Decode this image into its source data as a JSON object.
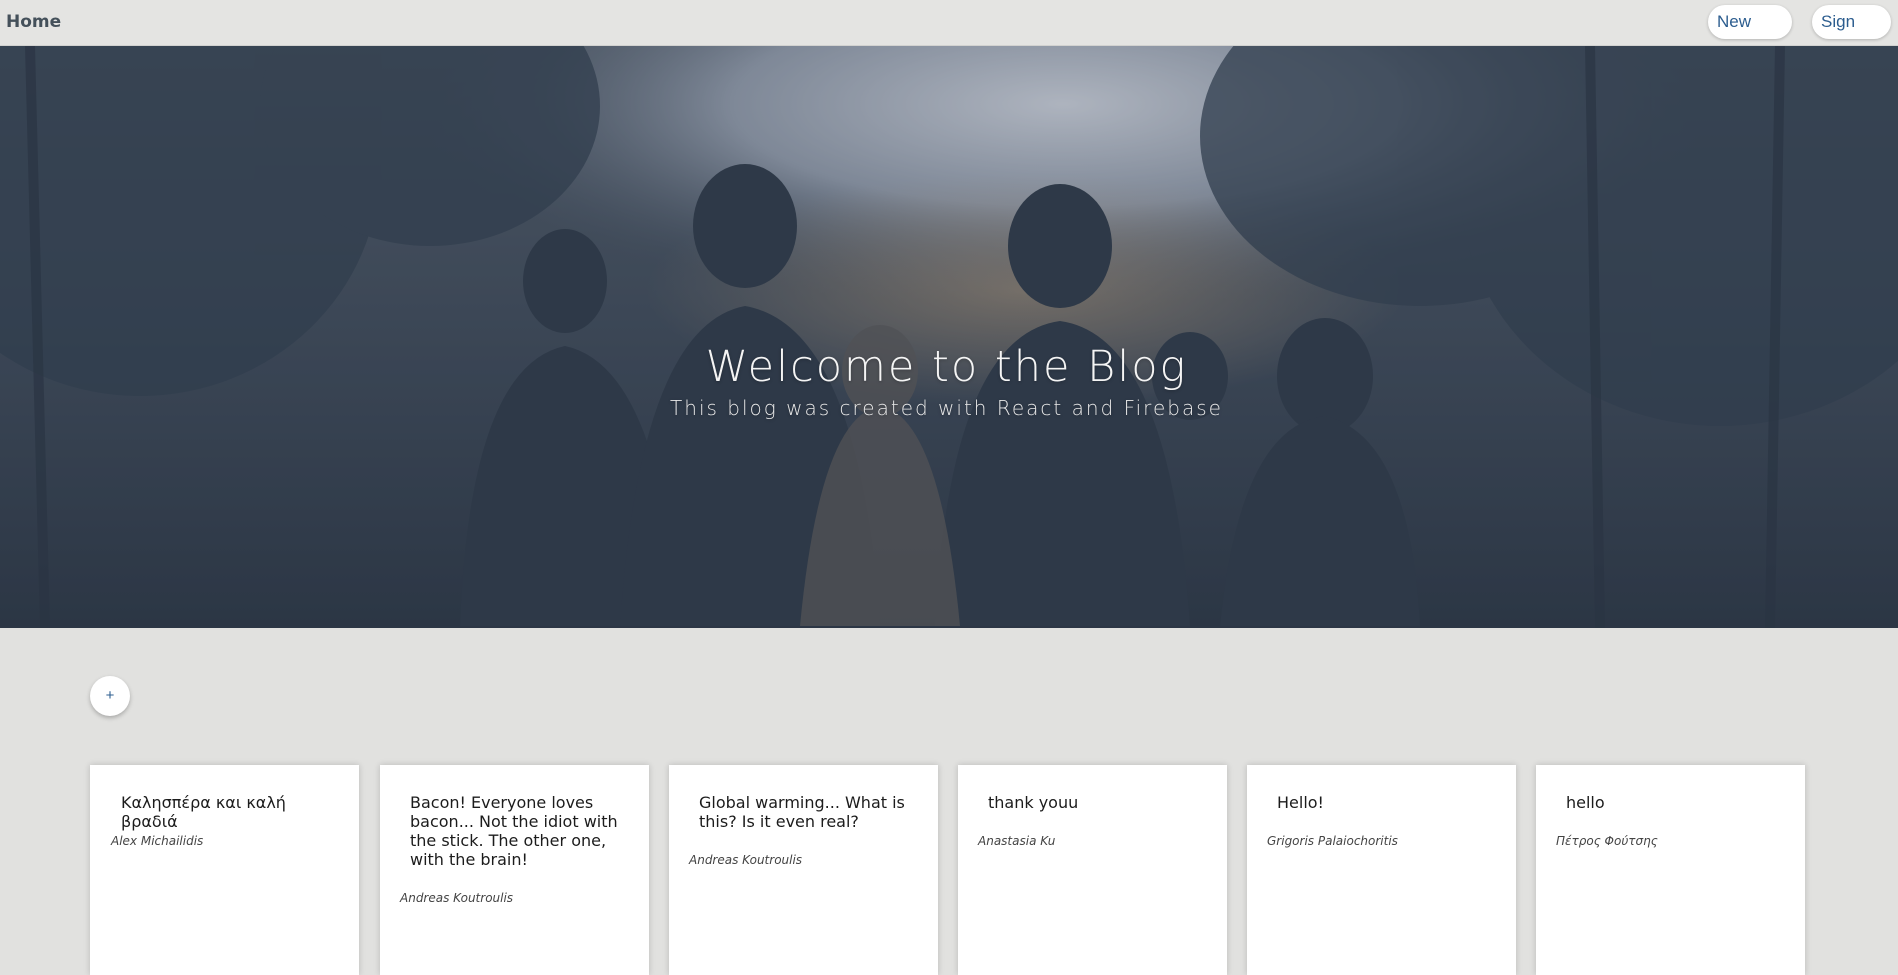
{
  "navbar": {
    "home_label": "Home",
    "new_post_label": "New Post",
    "sign_out_label": "Sign Out"
  },
  "hero": {
    "title": "Welcome to the Blog",
    "subtitle": "This blog was created with React and Firebase"
  },
  "add_button": {
    "label": "+"
  },
  "posts": [
    {
      "title": "Καλησπέρα και καλή βραδιά",
      "author": "Alex Michailidis"
    },
    {
      "title": "Bacon! Everyone loves bacon... Not the idiot with the stick. The other one, with the brain!",
      "author": "Andreas Koutroulis"
    },
    {
      "title": "Global warming... What is this? Is it even real?",
      "author": "Andreas Koutroulis"
    },
    {
      "title": "thank youu",
      "author": "Anastasia Ku"
    },
    {
      "title": "Hello!",
      "author": "Grigoris Palaiochoritis"
    },
    {
      "title": "hello",
      "author": "Πέτρος Φούτσης"
    }
  ],
  "colors": {
    "background": "#e1e1df",
    "navbar": "#e4e4e2",
    "accent": "#2c5d8f",
    "hero_overlay": "#3b4756"
  }
}
